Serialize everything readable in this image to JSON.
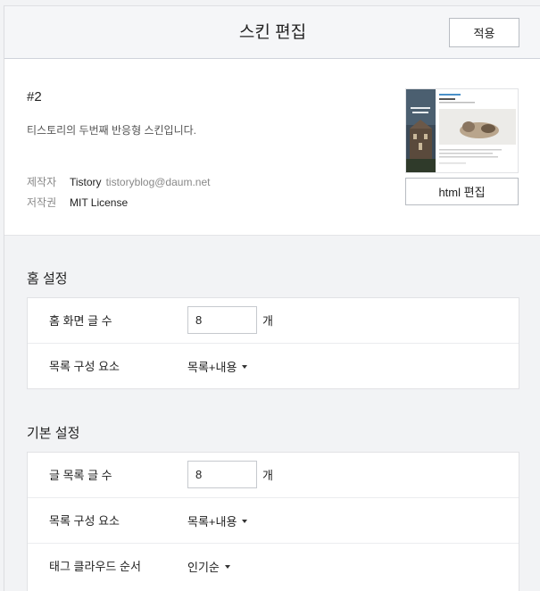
{
  "header": {
    "title": "스킨 편집",
    "apply_label": "적용"
  },
  "skin": {
    "name": "#2",
    "description": "티스토리의 두번째 반응형 스킨입니다.",
    "author_key": "제작자",
    "author_name": "Tistory",
    "author_email": "tistoryblog@daum.net",
    "license_key": "저작권",
    "license_value": "MIT License",
    "html_edit_label": "html 편집"
  },
  "home_settings": {
    "title": "홈 설정",
    "rows": [
      {
        "label": "홈 화면 글 수",
        "type": "number",
        "value": "8",
        "unit": "개"
      },
      {
        "label": "목록 구성 요소",
        "type": "select",
        "value": "목록+내용"
      }
    ]
  },
  "basic_settings": {
    "title": "기본 설정",
    "rows": [
      {
        "label": "글 목록 글 수",
        "type": "number",
        "value": "8",
        "unit": "개"
      },
      {
        "label": "목록 구성 요소",
        "type": "select",
        "value": "목록+내용"
      },
      {
        "label": "태그 클라우드 순서",
        "type": "select",
        "value": "인기순"
      }
    ]
  },
  "colors": {
    "thumb_left": "#3b4a58",
    "thumb_right": "#ffffff"
  }
}
